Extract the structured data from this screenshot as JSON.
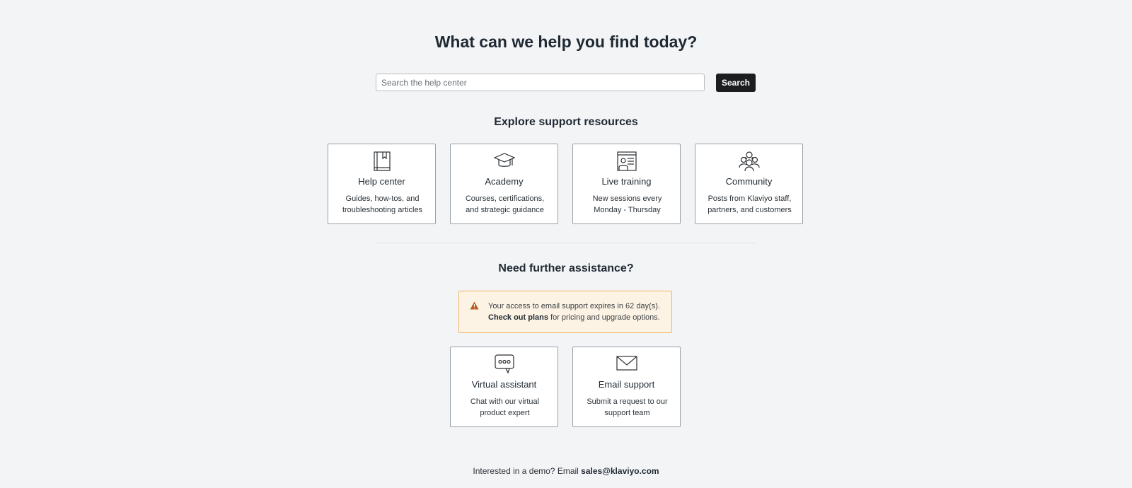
{
  "hero": {
    "title": "What can we help you find today?"
  },
  "search": {
    "placeholder": "Search the help center",
    "value": "",
    "button_label": "Search"
  },
  "resources": {
    "heading": "Explore support resources",
    "cards": [
      {
        "icon": "book-icon",
        "title": "Help center",
        "desc_line1": "Guides, how-tos, and",
        "desc_line2": "troubleshooting articles"
      },
      {
        "icon": "graduation-cap-icon",
        "title": "Academy",
        "desc_line1": "Courses, certifications,",
        "desc_line2": "and strategic guidance"
      },
      {
        "icon": "presenter-board-icon",
        "title": "Live training",
        "desc_line1": "New sessions every",
        "desc_line2": "Monday - Thursday"
      },
      {
        "icon": "people-group-icon",
        "title": "Community",
        "desc_line1": "Posts from Klaviyo staff,",
        "desc_line2": "partners, and customers"
      }
    ]
  },
  "assistance": {
    "heading": "Need further assistance?",
    "alert": {
      "icon": "warning-icon",
      "text_main": "Your access to email support expires in 62 day(s).",
      "link_label": "Check out plans",
      "text_after_link": " for pricing and upgrade options."
    },
    "cards": [
      {
        "icon": "chat-bubble-icon",
        "title": "Virtual assistant",
        "desc_line1": "Chat with our virtual",
        "desc_line2": "product expert"
      },
      {
        "icon": "envelope-icon",
        "title": "Email support",
        "desc_line1": "Submit a request to our",
        "desc_line2": "support team"
      }
    ]
  },
  "footer": {
    "text": "Interested in a demo? Email ",
    "email": "sales@klaviyo.com"
  },
  "colors": {
    "background": "#f3f4f6",
    "search_button": "#1b1d1f",
    "alert_background": "#fdf3e4",
    "alert_border": "#f1b563",
    "warning_icon": "#b35c1e"
  }
}
